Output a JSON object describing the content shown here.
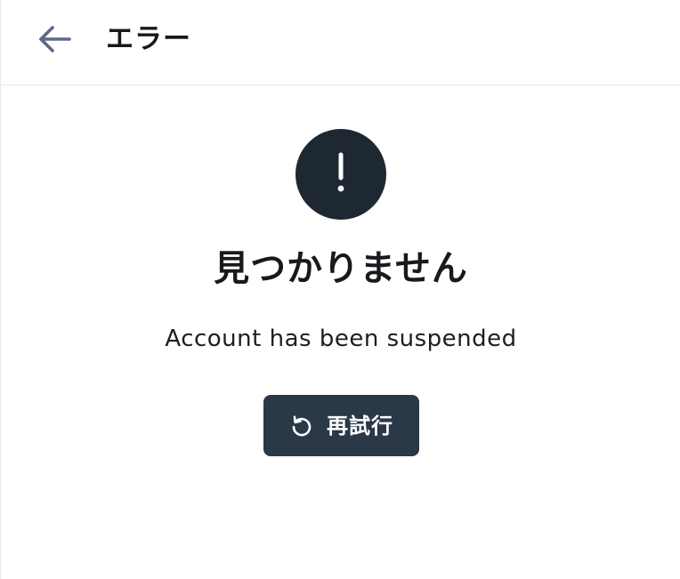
{
  "header": {
    "title": "エラー",
    "back_icon": "arrow-left-icon"
  },
  "error": {
    "icon": "exclamation-icon",
    "title": "見つかりません",
    "message": "Account has been suspended"
  },
  "retry_button": {
    "icon": "refresh-icon",
    "label": "再試行"
  },
  "colors": {
    "icon_circle": "#1d2833",
    "button_bg": "#2a3848",
    "back_icon": "#5a6b82",
    "text": "#17191c",
    "divider": "#e6e8eb"
  }
}
